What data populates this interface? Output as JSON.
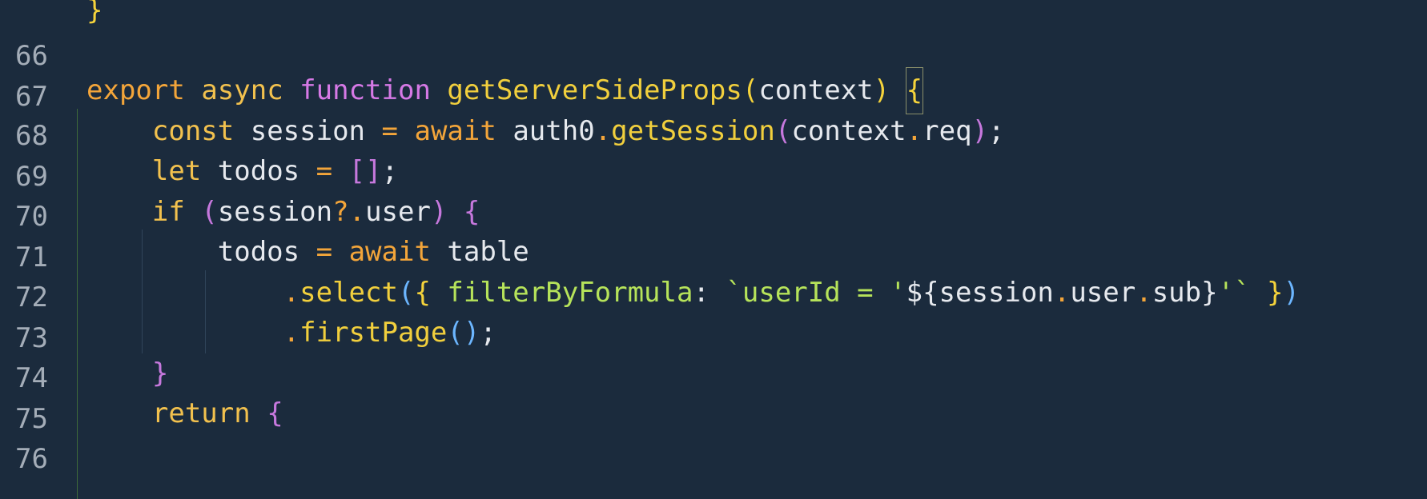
{
  "editor": {
    "language": "javascript",
    "lines": [
      {
        "number": "66"
      },
      {
        "number": "67"
      },
      {
        "number": "68"
      },
      {
        "number": "69"
      },
      {
        "number": "70"
      },
      {
        "number": "71"
      },
      {
        "number": "72"
      },
      {
        "number": "73"
      },
      {
        "number": "74"
      },
      {
        "number": "75"
      },
      {
        "number": "76"
      }
    ],
    "tokens": {
      "l66_brace": "}",
      "l68_export": "export",
      "l68_async": "async",
      "l68_function": "function",
      "l68_name": "getServerSideProps",
      "l68_open_paren": "(",
      "l68_param": "context",
      "l68_close_paren": ")",
      "l68_brace": "{",
      "l69_const": "const",
      "l69_session": "session",
      "l69_eq": "=",
      "l69_await": "await",
      "l69_auth0": "auth0",
      "l69_dot": ".",
      "l69_method": "getSession",
      "l69_open_paren": "(",
      "l69_context": "context",
      "l69_dot2": ".",
      "l69_req": "req",
      "l69_close_paren": ")",
      "l69_semi": ";",
      "l70_let": "let",
      "l70_todos": "todos",
      "l70_eq": "=",
      "l70_arr": "[]",
      "l70_semi": ";",
      "l71_if": "if",
      "l71_open_paren": "(",
      "l71_session": "session",
      "l71_optchain": "?.",
      "l71_user": "user",
      "l71_close_paren": ")",
      "l71_brace": "{",
      "l72_todos": "todos",
      "l72_eq": "=",
      "l72_await": "await",
      "l72_table": "table",
      "l73_dot": ".",
      "l73_select": "select",
      "l73_open_paren": "(",
      "l73_open_brace": "{",
      "l73_key": "filterByFormula",
      "l73_colon": ":",
      "l73_template_start": "`userId = '",
      "l73_interp_open": "${",
      "l73_session": "session",
      "l73_dot2": ".",
      "l73_user": "user",
      "l73_dot3": ".",
      "l73_sub": "sub",
      "l73_interp_close": "}",
      "l73_template_end": "'`",
      "l73_close_brace": "}",
      "l73_close_paren": ")",
      "l74_dot": ".",
      "l74_firstPage": "firstPage",
      "l74_parens": "()",
      "l74_semi": ";",
      "l75_brace": "}",
      "l76_return": "return",
      "l76_brace": "{"
    }
  }
}
